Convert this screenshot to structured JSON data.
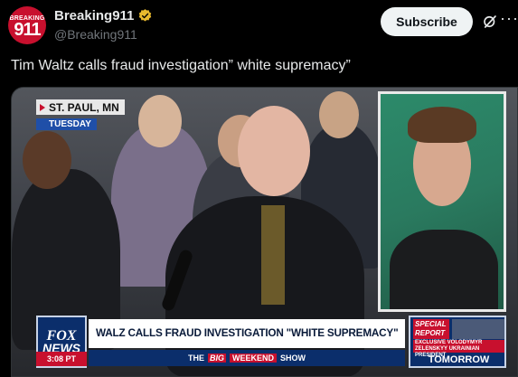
{
  "post": {
    "author": {
      "display_name": "Breaking911",
      "handle": "@Breaking911",
      "avatar_top_text": "BREAKING",
      "avatar_main_text": "911",
      "verified_icon": "verified-badge-icon",
      "verified_color": "#e8b92e"
    },
    "subscribe_label": "Subscribe",
    "text": "Tim Waltz calls fraud investigation” white supremacy”"
  },
  "video": {
    "location_city": "ST. PAUL, MN",
    "location_day": "TUESDAY",
    "network_logo_line1": "FOX",
    "network_logo_line2": "NEWS",
    "time": "3:08 PT",
    "headline": "WALZ CALLS FRAUD INVESTIGATION \"WHITE SUPREMACY\"",
    "subbar_prefix": "THE",
    "subbar_big": "BIG",
    "subbar_weekend": "WEEKEND",
    "subbar_show": "SHOW",
    "promo_special": "SPECIAL REPORT",
    "promo_exclusive": "EXCLUSIVE VOLODYMYR ZELENSKYY UKRAINIAN PRESIDENT",
    "promo_tomorrow": "TOMORROW"
  },
  "colors": {
    "background": "#000000",
    "subscribe_bg": "#eff3f4",
    "fox_blue": "#0b2e6b",
    "fox_red": "#c8102e"
  }
}
